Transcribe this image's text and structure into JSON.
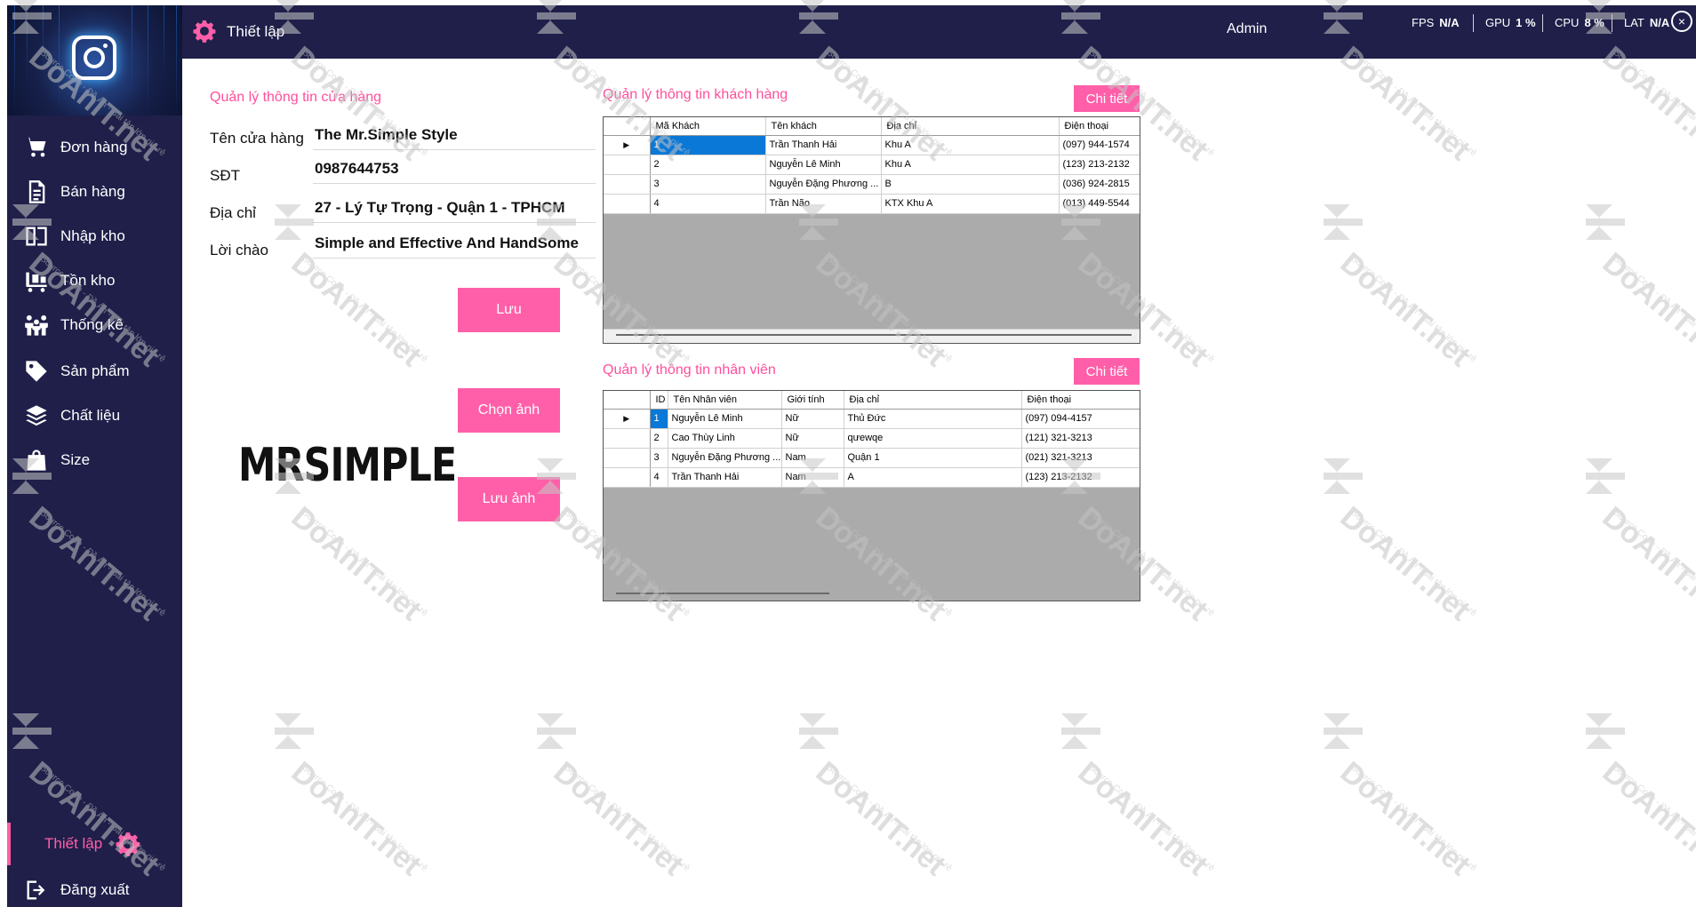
{
  "header": {
    "title": "Thiết lập",
    "user": "Admin",
    "stats": [
      {
        "label": "FPS",
        "value": "N/A"
      },
      {
        "label": "GPU",
        "value": "1 %"
      },
      {
        "label": "CPU",
        "value": "8 %"
      },
      {
        "label": "LAT",
        "value": "N/A"
      }
    ]
  },
  "sidebar": {
    "items": [
      {
        "label": "Đơn hàng",
        "icon": "cart-icon"
      },
      {
        "label": "Bán hàng",
        "icon": "document-icon"
      },
      {
        "label": "Nhập kho",
        "icon": "import-icon"
      },
      {
        "label": "Tồn kho",
        "icon": "inventory-icon"
      },
      {
        "label": "Thống kê",
        "icon": "people-icon"
      },
      {
        "label": "Sản phẩm",
        "icon": "tag-icon"
      },
      {
        "label": "Chất liệu",
        "icon": "layers-icon"
      },
      {
        "label": "Size",
        "icon": "bag-icon"
      }
    ],
    "settings": "Thiết lập",
    "logout": "Đăng xuất"
  },
  "store": {
    "title": "Quản lý thông tin cửa hàng",
    "fields": [
      {
        "label": "Tên cửa hàng",
        "value": "The Mr.Simple Style"
      },
      {
        "label": "SĐT",
        "value": "0987644753"
      },
      {
        "label": "Địa chỉ",
        "value": "27 - Lý Tự Trọng - Quận 1 - TPHCM"
      },
      {
        "label": "Lời chào",
        "value": "Simple and Effective And HandSome"
      }
    ],
    "save_label": "Lưu",
    "choose_image_label": "Chọn ảnh",
    "save_image_label": "Lưu ảnh",
    "brand_logo": "MRSIMPLE"
  },
  "customers": {
    "title": "Quản lý thông tin khách hàng",
    "detail_label": "Chi tiết",
    "columns": [
      "Mã Khách",
      "Tên khách",
      "Địa chỉ",
      "Điện thoại"
    ],
    "rows": [
      [
        "1",
        "Trần Thanh Hải",
        "Khu A",
        "(097) 944-1574"
      ],
      [
        "2",
        "Nguyễn Lê Minh",
        "Khu A",
        "(123) 213-2132"
      ],
      [
        "3",
        "Nguyễn Đặng Phương ...",
        "B",
        "(036) 924-2815"
      ],
      [
        "4",
        "Trần Não",
        "KTX Khu A",
        "(013) 449-5544"
      ]
    ]
  },
  "staff": {
    "title": "Quản lý thông tin nhân viên",
    "detail_label": "Chi tiết",
    "columns": [
      "ID",
      "Tên Nhân viên",
      "Giới tính",
      "Địa chỉ",
      "Điện thoại"
    ],
    "rows": [
      [
        "1",
        "Nguyễn Lê Minh",
        "Nữ",
        "Thủ Đức",
        "(097) 094-4157"
      ],
      [
        "2",
        "Cao Thùy Linh",
        "Nữ",
        "qưewqe",
        "(121) 321-3213"
      ],
      [
        "3",
        "Nguyễn Đặng Phương ...",
        "Nam",
        "Quận 1",
        "(021) 321-3213"
      ],
      [
        "4",
        "Trần Thanh Hải",
        "Nam",
        "A",
        "(123) 213-2132"
      ]
    ]
  },
  "watermark": {
    "brand": "DoAnIT.net",
    "tagline": "Source Code - Đồ Án - Bài tập lớn giá rẻ"
  },
  "colors": {
    "navy": "#1f1f4a",
    "accent": "#ff5fa8",
    "selection": "#0a78d7"
  }
}
